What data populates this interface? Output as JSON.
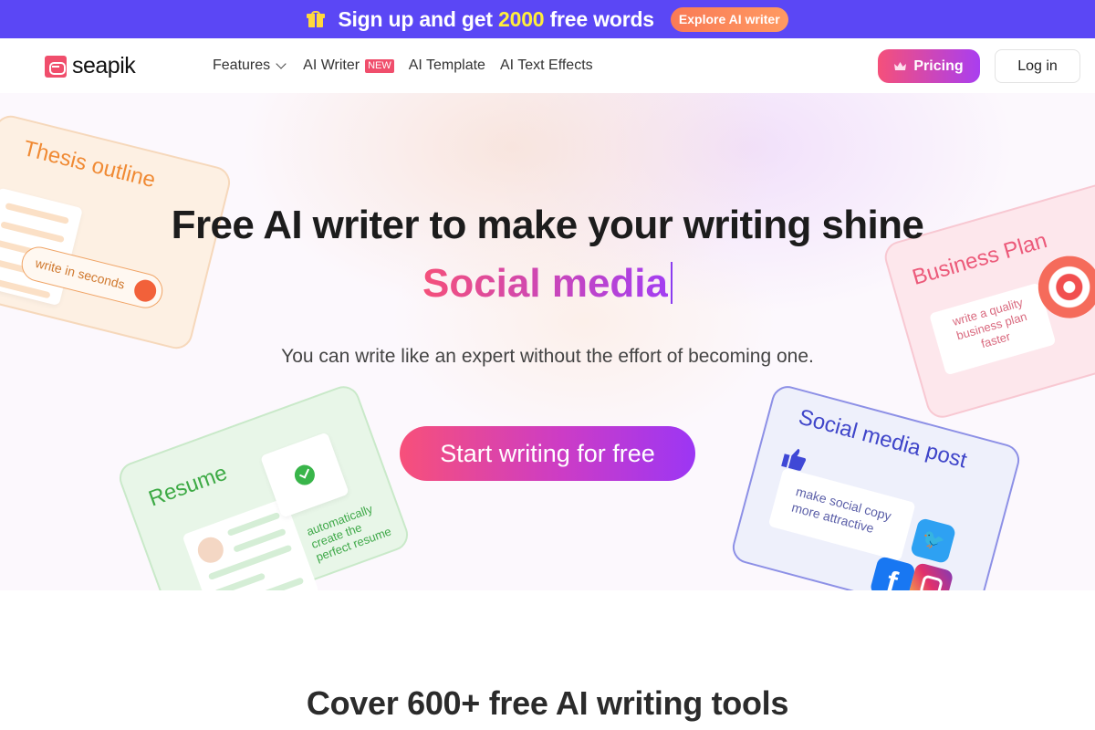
{
  "promo": {
    "icon": "gift-icon",
    "text_before": "Sign up and get ",
    "highlight": "2000",
    "text_after": " free words",
    "button_label": "Explore AI writer",
    "colors": {
      "background": "#5b47f5",
      "highlight": "#ffee3b",
      "button": "#f97a55"
    }
  },
  "nav": {
    "logo_text": "seapik",
    "items": [
      {
        "label": "Features",
        "has_dropdown": true
      },
      {
        "label": "AI Writer",
        "badge": "NEW"
      },
      {
        "label": "AI Template"
      },
      {
        "label": "AI Text Effects"
      }
    ],
    "pricing_label": "Pricing",
    "pricing_icon": "crown-icon",
    "login_label": "Log in"
  },
  "hero": {
    "title": "Free AI writer to make your writing shine",
    "typed_text": "Social media",
    "subtitle": "You can write like an expert without the effort of becoming one.",
    "cta_label": "Start writing for free",
    "cards": {
      "thesis": {
        "title": "Thesis outline",
        "caption": "write in seconds"
      },
      "business": {
        "title": "Business Plan",
        "caption_lines": [
          "write a quality",
          "business plan",
          "faster"
        ]
      },
      "resume": {
        "title": "Resume",
        "caption_lines": [
          "automatically",
          "create the",
          "perfect resume"
        ]
      },
      "social": {
        "title": "Social media post",
        "caption_lines": [
          "make social copy",
          "more attractive"
        ]
      }
    }
  },
  "section": {
    "title": "Cover 600+ free AI writing tools"
  }
}
